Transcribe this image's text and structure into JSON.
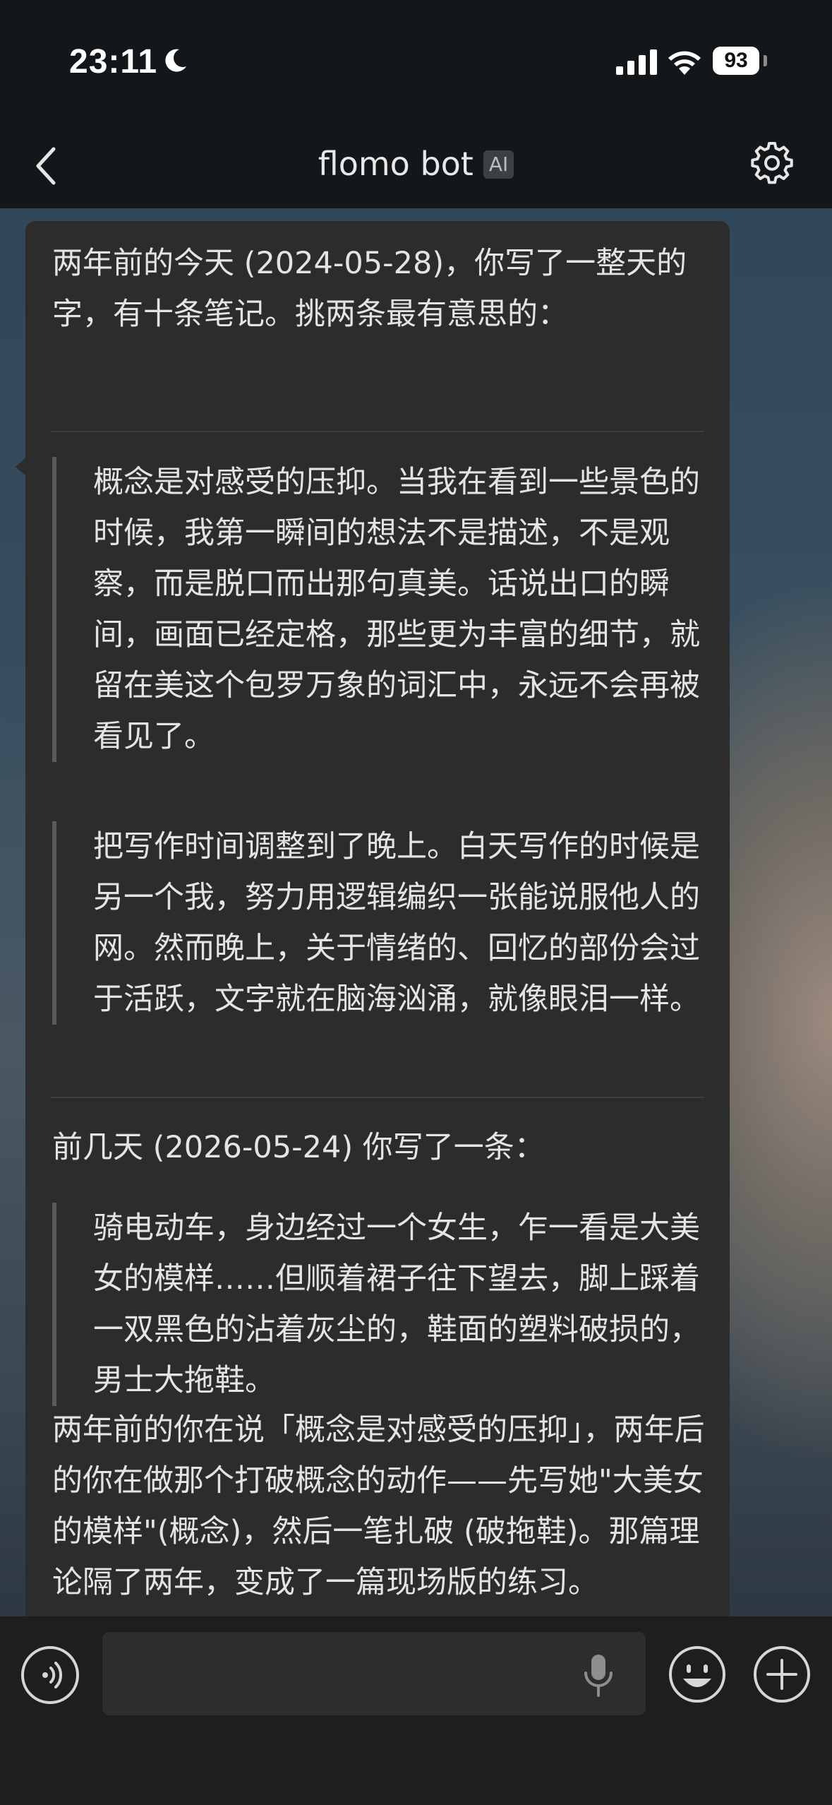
{
  "status_bar": {
    "time": "23:11",
    "battery": "93",
    "icons": [
      "moon-icon",
      "signal-icon",
      "wifi-icon",
      "battery-icon"
    ]
  },
  "nav": {
    "title": "flomo bot",
    "badge": "AI",
    "icons": [
      "back-icon",
      "gear-icon"
    ]
  },
  "message": {
    "intro": "两年前的今天 (2024-05-28)，你写了一整天的字，有十条笔记。挑两条最有意思的：",
    "quotes": [
      "概念是对感受的压抑。当我在看到一些景色的时候，我第一瞬间的想法不是描述，不是观察，而是脱口而出那句真美。话说出口的瞬间，画面已经定格，那些更为丰富的细节，就留在美这个包罗万象的词汇中，永远不会再被看见了。",
      "把写作时间调整到了晚上。白天写作的时候是另一个我，努力用逻辑编织一张能说服他人的网。然而晚上，关于情绪的、回忆的部份会过于活跃，文字就在脑海汹涌，就像眼泪一样。"
    ],
    "recent_intro": "前几天 (2026-05-24) 你写了一条：",
    "recent_quote": "骑电动车，身边经过一个女生，乍一看是大美女的模样……但顺着裙子往下望去，脚上踩着一双黑色的沾着灰尘的，鞋面的塑料破损的，男士大拖鞋。",
    "comment": "两年前的你在说「概念是对感受的压抑」，两年后的你在做那个打破概念的动作——先写她\"大美女的模样\"(概念)，然后一笔扎破 (破拖鞋)。那篇理论隔了两年，变成了一篇现场版的练习。"
  },
  "input_bar": {
    "placeholder": "",
    "icons": [
      "voice-icon",
      "mic-icon",
      "emoji-icon",
      "add-icon"
    ]
  },
  "colors": {
    "bubble": "#2c2c2c",
    "bar": "#13171a",
    "input_bar": "#1e1e1e"
  }
}
